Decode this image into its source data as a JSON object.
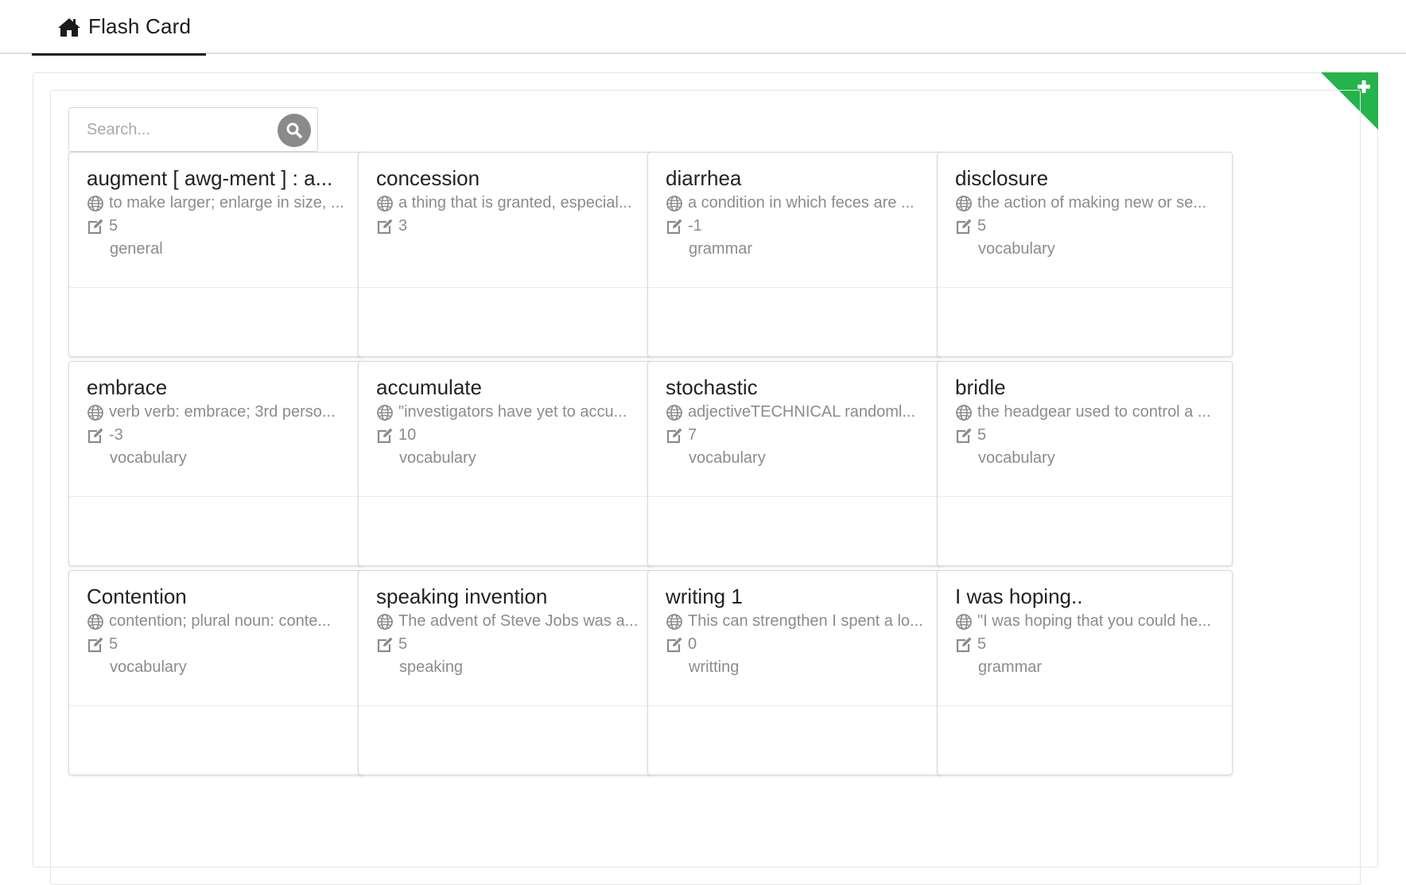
{
  "nav": {
    "home_tab_label": "Flash Card"
  },
  "search": {
    "placeholder": "Search..."
  },
  "colors": {
    "add_corner": "#25b34b",
    "search_button": "#8a8a8a"
  },
  "cards": [
    {
      "title": "augment [ awg-ment ] : a...",
      "definition": "to make larger; enlarge in size, ...",
      "score": "5",
      "category": "general"
    },
    {
      "title": "concession",
      "definition": "a thing that is granted, especial...",
      "score": "3",
      "category": ""
    },
    {
      "title": "diarrhea",
      "definition": "a condition in which feces are ...",
      "score": "-1",
      "category": "grammar"
    },
    {
      "title": "disclosure",
      "definition": "the action of making new or se...",
      "score": "5",
      "category": "vocabulary"
    },
    {
      "title": "embrace",
      "definition": "verb verb: embrace; 3rd perso...",
      "score": "-3",
      "category": "vocabulary"
    },
    {
      "title": "accumulate",
      "definition": "\"investigators have yet to accu...",
      "score": "10",
      "category": "vocabulary"
    },
    {
      "title": "stochastic",
      "definition": "adjectiveTECHNICAL randoml...",
      "score": "7",
      "category": "vocabulary"
    },
    {
      "title": "bridle",
      "definition": "the headgear used to control a ...",
      "score": "5",
      "category": "vocabulary"
    },
    {
      "title": "Contention",
      "definition": "contention; plural noun: conte...",
      "score": "5",
      "category": "vocabulary"
    },
    {
      "title": "speaking invention",
      "definition": "The advent of Steve Jobs was a...",
      "score": "5",
      "category": "speaking"
    },
    {
      "title": "writing 1",
      "definition": "This can strengthen I spent a lo...",
      "score": "0",
      "category": "writting"
    },
    {
      "title": "I was hoping..",
      "definition": "\"I was hoping that you could he...",
      "score": "5",
      "category": "grammar"
    }
  ]
}
